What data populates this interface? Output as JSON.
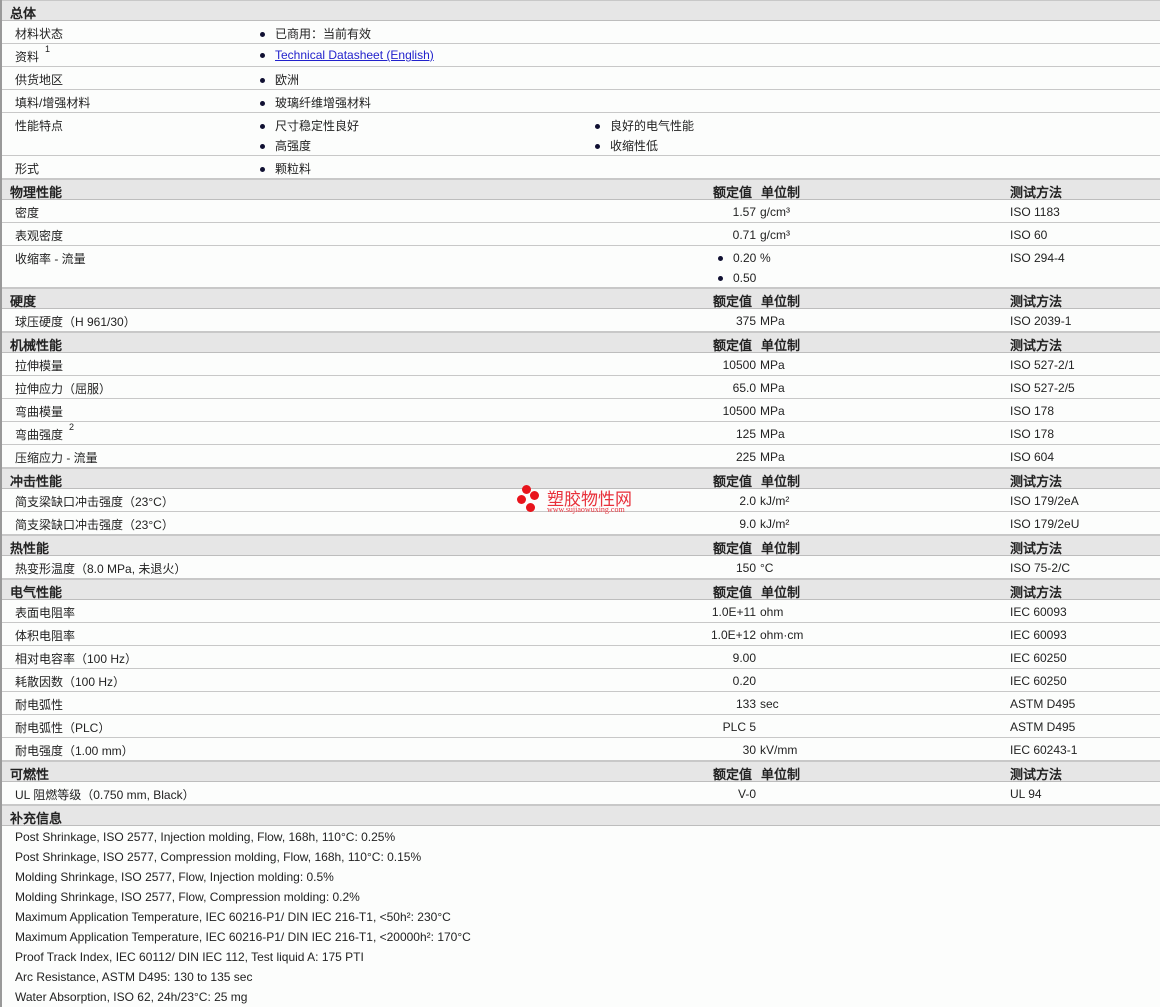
{
  "general": {
    "title": "总体",
    "rows": [
      {
        "label": "材料状态",
        "values": [
          "已商用：当前有效"
        ]
      },
      {
        "label": "资料",
        "sup": "1",
        "values": [
          "Technical Datasheet (English)"
        ],
        "link": true
      },
      {
        "label": "供货地区",
        "values": [
          "欧洲"
        ]
      },
      {
        "label": "填料/增强材料",
        "values": [
          "玻璃纤维增强材料"
        ]
      },
      {
        "label": "性能特点",
        "values": [
          "尺寸稳定性良好",
          "高强度"
        ],
        "values2": [
          "良好的电气性能",
          "收缩性低"
        ]
      },
      {
        "label": "形式",
        "values": [
          "颗粒料"
        ]
      }
    ]
  },
  "col_headers": {
    "value": "额定值",
    "unit": "单位制",
    "method": "测试方法"
  },
  "sections": [
    {
      "title": "物理性能",
      "rows": [
        {
          "label": "密度",
          "value": "1.57",
          "unit": "g/cm³",
          "method": "ISO 1183"
        },
        {
          "label": "表观密度",
          "value": "0.71",
          "unit": "g/cm³",
          "method": "ISO 60"
        },
        {
          "label": "收缩率 - 流量",
          "values": [
            "0.20",
            "0.50"
          ],
          "unit": "%",
          "method": "ISO 294-4"
        }
      ]
    },
    {
      "title": "硬度",
      "rows": [
        {
          "label": "球压硬度（H 961/30）",
          "value": "375",
          "unit": "MPa",
          "method": "ISO 2039-1"
        }
      ]
    },
    {
      "title": "机械性能",
      "rows": [
        {
          "label": "拉伸模量",
          "value": "10500",
          "unit": "MPa",
          "method": "ISO 527-2/1"
        },
        {
          "label": "拉伸应力（屈服）",
          "value": "65.0",
          "unit": "MPa",
          "method": "ISO 527-2/5"
        },
        {
          "label": "弯曲模量",
          "value": "10500",
          "unit": "MPa",
          "method": "ISO 178"
        },
        {
          "label": "弯曲强度",
          "sup": "2",
          "value": "125",
          "unit": "MPa",
          "method": "ISO 178"
        },
        {
          "label": "压缩应力 - 流量",
          "value": "225",
          "unit": "MPa",
          "method": "ISO 604"
        }
      ]
    },
    {
      "title": "冲击性能",
      "rows": [
        {
          "label": "简支梁缺口冲击强度（23°C）",
          "value": "2.0",
          "unit": "kJ/m²",
          "method": "ISO 179/2eA"
        },
        {
          "label": "简支梁缺口冲击强度（23°C）",
          "value": "9.0",
          "unit": "kJ/m²",
          "method": "ISO 179/2eU"
        }
      ]
    },
    {
      "title": "热性能",
      "rows": [
        {
          "label": "热变形温度（8.0 MPa, 未退火）",
          "value": "150",
          "unit": "°C",
          "method": "ISO 75-2/C"
        }
      ]
    },
    {
      "title": "电气性能",
      "rows": [
        {
          "label": "表面电阻率",
          "value": "1.0E+11",
          "unit": "ohm",
          "method": "IEC 60093"
        },
        {
          "label": "体积电阻率",
          "value": "1.0E+12",
          "unit": "ohm·cm",
          "method": "IEC 60093"
        },
        {
          "label": "相对电容率（100 Hz）",
          "value": "9.00",
          "unit": "",
          "method": "IEC 60250"
        },
        {
          "label": "耗散因数（100 Hz）",
          "value": "0.20",
          "unit": "",
          "method": "IEC 60250"
        },
        {
          "label": "耐电弧性",
          "value": "133",
          "unit": "sec",
          "method": "ASTM D495"
        },
        {
          "label": "耐电弧性（PLC）",
          "value": "PLC 5",
          "unit": "",
          "method": "ASTM D495"
        },
        {
          "label": "耐电强度（1.00 mm）",
          "value": "30",
          "unit": "kV/mm",
          "method": "IEC 60243-1"
        }
      ]
    },
    {
      "title": "可燃性",
      "rows": [
        {
          "label": "UL 阻燃等级（0.750 mm, Black）",
          "value": "V-0",
          "unit": "",
          "method": "UL 94"
        }
      ]
    }
  ],
  "supplementary": {
    "title": "补充信息",
    "lines": [
      "Post Shrinkage, ISO 2577, Injection molding, Flow, 168h, 110°C: 0.25%",
      "Post Shrinkage, ISO 2577, Compression molding, Flow, 168h, 110°C: 0.15%",
      "Molding Shrinkage, ISO 2577, Flow, Injection molding: 0.5%",
      "Molding Shrinkage, ISO 2577, Flow, Compression molding: 0.2%",
      "Maximum Application Temperature, IEC 60216-P1/ DIN IEC 216-T1, <50h²: 230°C",
      "Maximum Application Temperature, IEC 60216-P1/ DIN IEC 216-T1, <20000h²: 170°C",
      "Proof Track Index, IEC 60112/ DIN IEC 112, Test liquid A: 175 PTI",
      "Arc Resistance, ASTM D495: 130 to 135 sec",
      "Water Absorption, ISO 62, 24h/23°C: 25 mg"
    ]
  },
  "watermark": {
    "text": "塑胶物性网",
    "url": "www.sujiaowuxing.com"
  }
}
